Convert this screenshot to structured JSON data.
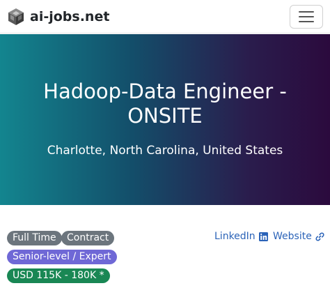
{
  "navbar": {
    "brand": "ai-jobs.net",
    "logo_icon": "cube-logo-icon",
    "menu_icon": "hamburger-menu-icon"
  },
  "hero": {
    "title": "Hadoop-Data Engineer - ONSITE",
    "location": "Charlotte, North Carolina, United States"
  },
  "tags": {
    "employment_types": [
      "Full Time",
      "Contract"
    ],
    "level": "Senior-level / Expert",
    "salary": "USD 115K - 180K *"
  },
  "links": {
    "linkedin": "LinkedIn",
    "website": "Website",
    "linkedin_icon": "linkedin-icon",
    "website_icon": "link-icon"
  },
  "colors": {
    "badge_gray": "#6c757d",
    "badge_purple": "#6f68d6",
    "badge_green": "#198754",
    "link_blue": "#2b63b8",
    "hero_start": "#13858f",
    "hero_end": "#2b0a3d"
  }
}
